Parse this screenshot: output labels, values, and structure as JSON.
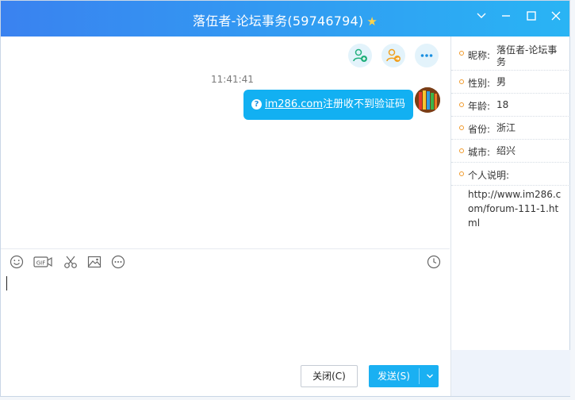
{
  "window": {
    "title": "落伍者-论坛事务(59746794)",
    "title_star": "★",
    "controls": [
      "chevron-down-icon",
      "minimize-icon",
      "maximize-icon",
      "close-icon"
    ]
  },
  "chat": {
    "actions": [
      "add-member-icon",
      "transfer-icon",
      "more-icon"
    ],
    "messages": [
      {
        "time": "11:41:41",
        "icon": "question-icon",
        "icon_text": "?",
        "link_text": "im286.com",
        "text": "注册收不到验证码"
      }
    ]
  },
  "toolbar": {
    "gif_label": "GIF",
    "tools": [
      "emoji-icon",
      "gif-icon",
      "scissors-icon",
      "image-icon",
      "more-icon",
      "history-clock-icon"
    ]
  },
  "buttons": {
    "close_label": "关闭(C)",
    "send_label": "发送(S)",
    "send_arrow": "∨"
  },
  "profile": {
    "nickname_label": "昵称:",
    "nickname": "落伍者-论坛事务",
    "gender_label": "性别:",
    "gender": "男",
    "age_label": "年龄:",
    "age": "18",
    "province_label": "省份:",
    "province": "浙江",
    "city_label": "城市:",
    "city": "绍兴",
    "bio_label": "个人说明:",
    "bio_url": "http://www.im286.com/forum-111-1.html"
  },
  "colors": {
    "title_gradient_start": "#3a82f0",
    "title_gradient_end": "#29b4f4",
    "bubble": "#12b0f2",
    "send_button": "#1ab0f2",
    "bullet": "#f19a2b"
  }
}
